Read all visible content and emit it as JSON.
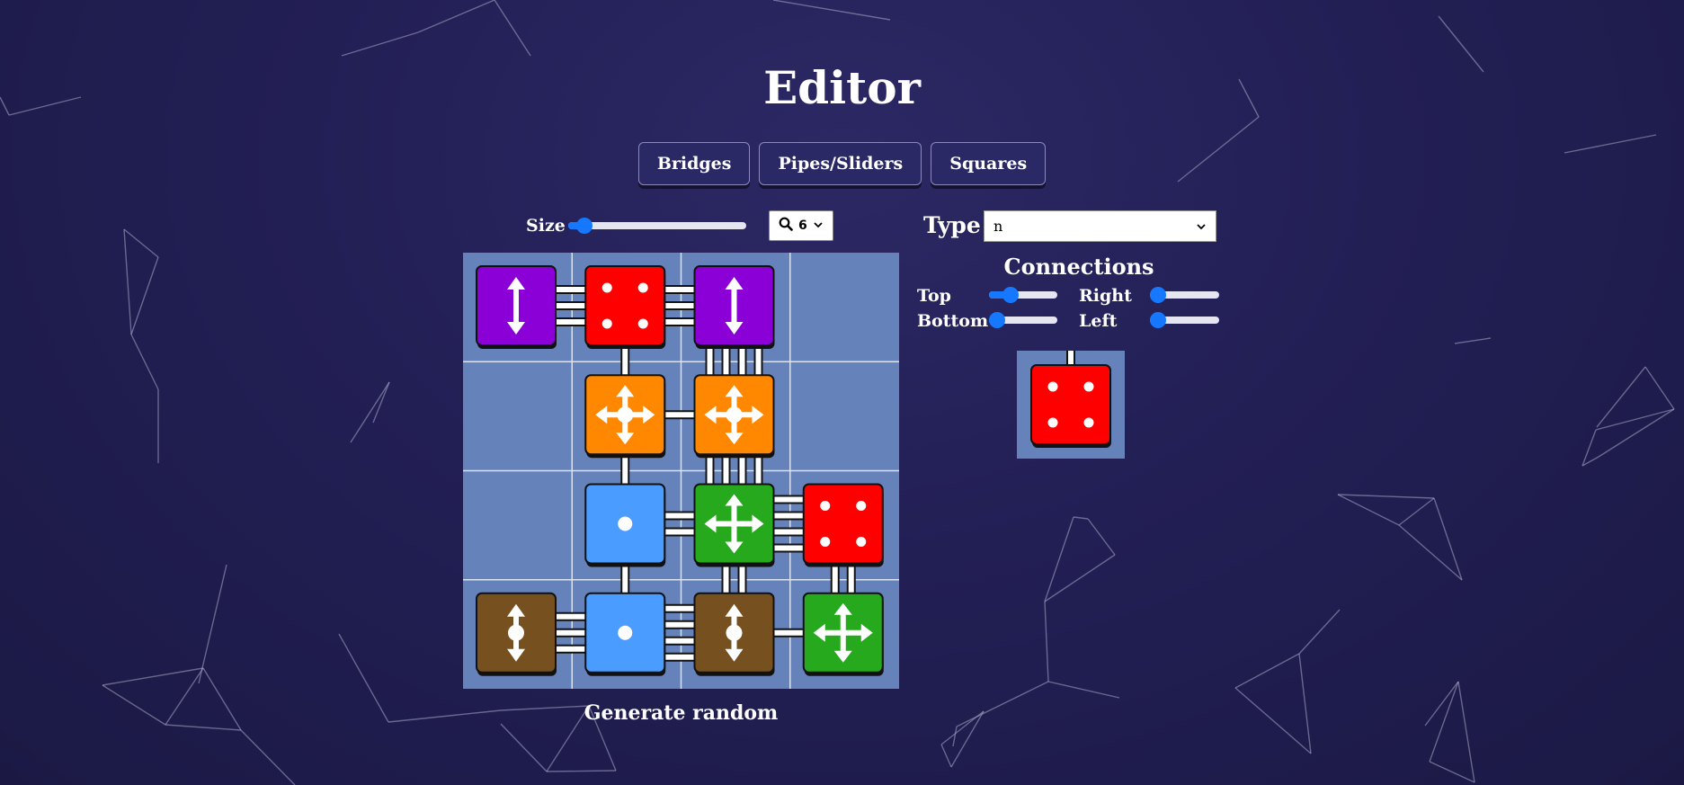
{
  "page": {
    "title": "Editor"
  },
  "tabs": [
    {
      "label": "Bridges"
    },
    {
      "label": "Pipes/Sliders"
    },
    {
      "label": "Squares"
    }
  ],
  "size_control": {
    "label": "Size",
    "value_fraction": 0.05,
    "zoom_value": "6"
  },
  "type_control": {
    "label": "Type",
    "value": "n"
  },
  "connections": {
    "title": "Connections",
    "top": {
      "label": "Top",
      "value_fraction": 0.25
    },
    "right": {
      "label": "Right",
      "value_fraction": 0.0
    },
    "bottom": {
      "label": "Bottom",
      "value_fraction": 0.0
    },
    "left": {
      "label": "Left",
      "value_fraction": 0.0
    }
  },
  "generate_label": "Generate random",
  "colors": {
    "grid_bg": "#6682ba",
    "red": "#ff0000",
    "purple": "#8a00d6",
    "orange": "#ff8800",
    "blue": "#4a9cff",
    "green": "#26a91c",
    "brown": "#76501f",
    "accent": "#1677ff"
  },
  "board": {
    "rows": 4,
    "cols": 4,
    "tiles": [
      {
        "row": 0,
        "col": 0,
        "color": "purple",
        "icon": "vertical-arrows"
      },
      {
        "row": 0,
        "col": 1,
        "color": "red",
        "icon": "four-dots"
      },
      {
        "row": 0,
        "col": 2,
        "color": "purple",
        "icon": "vertical-arrows"
      },
      {
        "row": 1,
        "col": 1,
        "color": "orange",
        "icon": "four-way-arrows-dot"
      },
      {
        "row": 1,
        "col": 2,
        "color": "orange",
        "icon": "four-way-arrows-dot"
      },
      {
        "row": 2,
        "col": 1,
        "color": "blue",
        "icon": "single-dot"
      },
      {
        "row": 2,
        "col": 2,
        "color": "green",
        "icon": "four-way-arrows"
      },
      {
        "row": 2,
        "col": 3,
        "color": "red",
        "icon": "four-dots"
      },
      {
        "row": 3,
        "col": 0,
        "color": "brown",
        "icon": "vertical-arrows-dot"
      },
      {
        "row": 3,
        "col": 1,
        "color": "blue",
        "icon": "single-dot"
      },
      {
        "row": 3,
        "col": 2,
        "color": "brown",
        "icon": "vertical-arrows-dot"
      },
      {
        "row": 3,
        "col": 3,
        "color": "green",
        "icon": "four-way-arrows"
      }
    ],
    "links": [
      {
        "from": [
          0,
          0
        ],
        "to": [
          0,
          1
        ],
        "count": 3
      },
      {
        "from": [
          0,
          1
        ],
        "to": [
          0,
          2
        ],
        "count": 3
      },
      {
        "from": [
          0,
          1
        ],
        "to": [
          1,
          1
        ],
        "count": 1
      },
      {
        "from": [
          0,
          2
        ],
        "to": [
          1,
          2
        ],
        "count": 4
      },
      {
        "from": [
          1,
          1
        ],
        "to": [
          1,
          2
        ],
        "count": 1
      },
      {
        "from": [
          1,
          1
        ],
        "to": [
          2,
          1
        ],
        "count": 1
      },
      {
        "from": [
          1,
          2
        ],
        "to": [
          2,
          2
        ],
        "count": 4
      },
      {
        "from": [
          2,
          1
        ],
        "to": [
          2,
          2
        ],
        "count": 2
      },
      {
        "from": [
          2,
          2
        ],
        "to": [
          2,
          3
        ],
        "count": 4
      },
      {
        "from": [
          2,
          1
        ],
        "to": [
          3,
          1
        ],
        "count": 1
      },
      {
        "from": [
          2,
          2
        ],
        "to": [
          3,
          2
        ],
        "count": 2
      },
      {
        "from": [
          2,
          3
        ],
        "to": [
          3,
          3
        ],
        "count": 2
      },
      {
        "from": [
          3,
          0
        ],
        "to": [
          3,
          1
        ],
        "count": 3
      },
      {
        "from": [
          3,
          1
        ],
        "to": [
          3,
          2
        ],
        "count": 4
      },
      {
        "from": [
          3,
          2
        ],
        "to": [
          3,
          3
        ],
        "count": 1
      }
    ]
  },
  "preview_tile": {
    "color": "red",
    "icon": "four-dots",
    "top_connections": 1
  }
}
